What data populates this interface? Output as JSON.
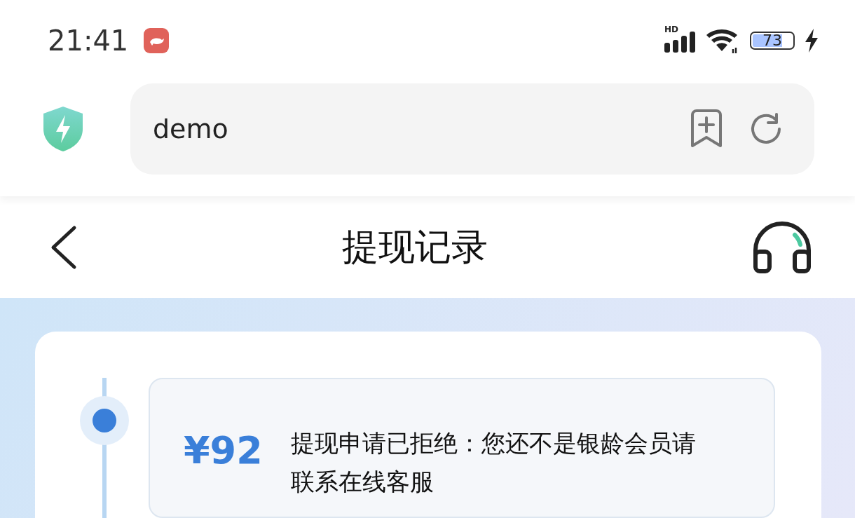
{
  "status_bar": {
    "time": "21:41",
    "network": "HD",
    "battery": "73"
  },
  "browser": {
    "address": "demo"
  },
  "header": {
    "title": "提现记录"
  },
  "records": [
    {
      "amount": "¥92",
      "message": "提现申请已拒绝：您还不是银龄会员请联系在线客服"
    }
  ]
}
